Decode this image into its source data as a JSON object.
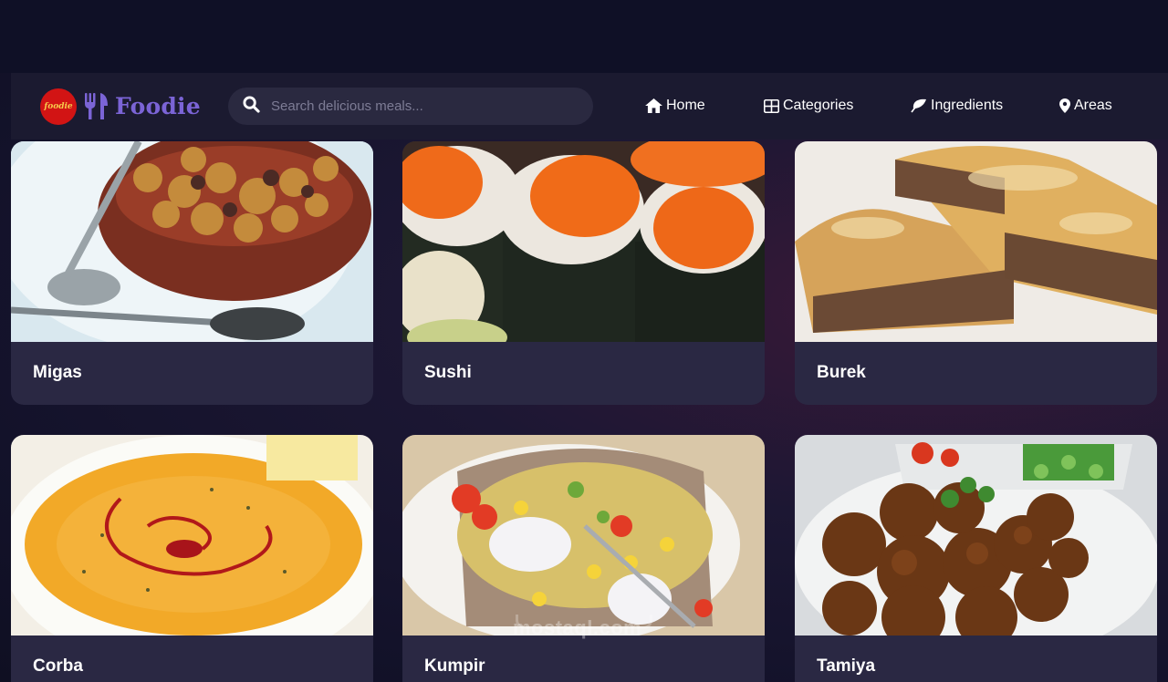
{
  "app": {
    "logo_text": "foodie",
    "brand": "Foodie"
  },
  "search": {
    "placeholder": "Search delicious meals...",
    "value": ""
  },
  "nav": [
    {
      "label": "Home",
      "icon": "home-icon"
    },
    {
      "label": "Categories",
      "icon": "grid-icon"
    },
    {
      "label": "Ingredients",
      "icon": "leaf-icon"
    },
    {
      "label": "Areas",
      "icon": "map-pin-icon"
    }
  ],
  "meals": [
    {
      "name": "Migas",
      "image": "migas-photo"
    },
    {
      "name": "Sushi",
      "image": "sushi-photo"
    },
    {
      "name": "Burek",
      "image": "burek-photo"
    },
    {
      "name": "Corba",
      "image": "corba-photo"
    },
    {
      "name": "Kumpir",
      "image": "kumpir-photo"
    },
    {
      "name": "Tamiya",
      "image": "tamiya-photo"
    }
  ],
  "watermark": "mostaql.com",
  "colors": {
    "brand": "#7b64d6",
    "background": "#13122a",
    "navbar": "#1b1a30",
    "card": "#2a2843",
    "logo_badge": "#d21414"
  }
}
